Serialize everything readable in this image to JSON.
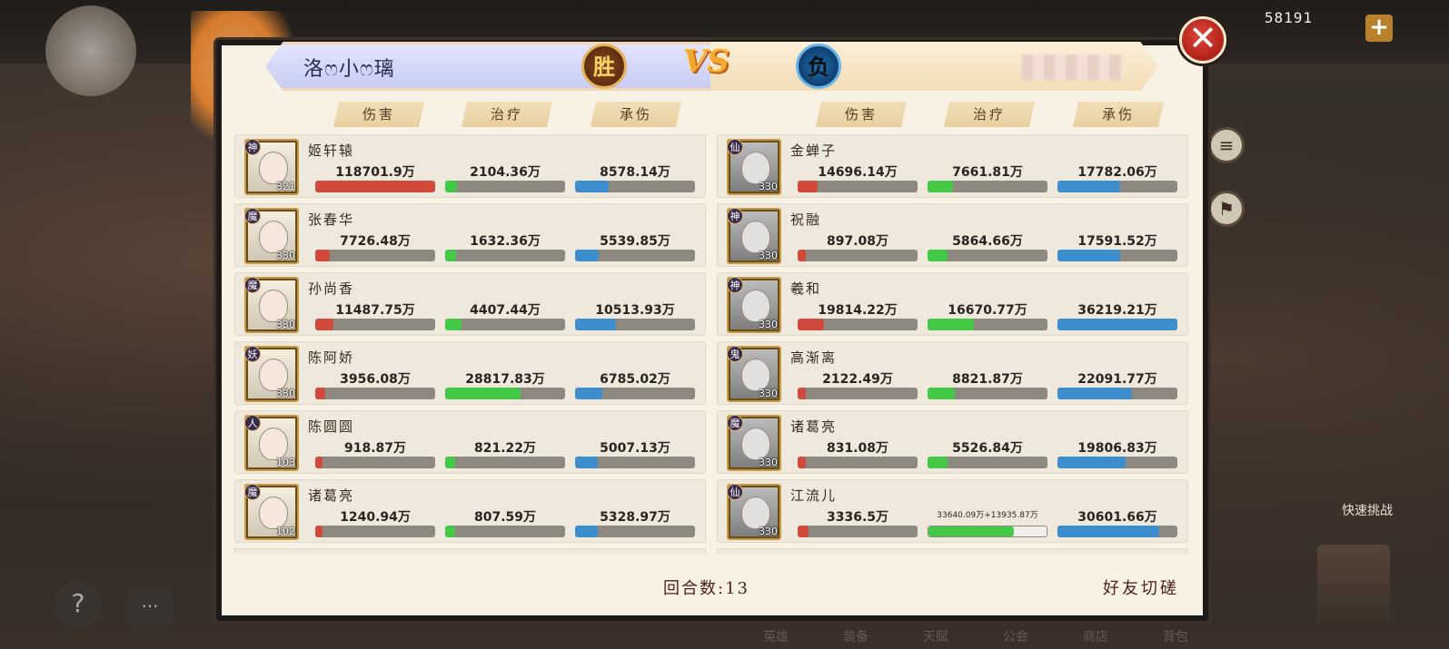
{
  "background": {
    "gold_amount": "58191",
    "plus_label": "+",
    "quick_challenge_label": "快速挑战",
    "help_label": "?",
    "chat_label": "···",
    "nav_items": [
      "英雄",
      "装备",
      "天赋",
      "公会",
      "商店",
      "背包"
    ]
  },
  "close_label": "✕",
  "banner": {
    "left_player": "洛ෆ小ෆ璃",
    "win_label": "胜",
    "vs_label": "VS",
    "lose_label": "负"
  },
  "columns": [
    "伤害",
    "治疗",
    "承伤"
  ],
  "colors": {
    "damage": "#d0493b",
    "heal": "#44c947",
    "tank": "#3e8ece"
  },
  "left_team": [
    {
      "name": "姬轩辕",
      "faction": "神",
      "level": "321",
      "dmg": "118701.9万",
      "heal": "2104.36万",
      "tank": "8578.14万",
      "dmg_pct": 100,
      "heal_pct": 10,
      "tank_pct": 28
    },
    {
      "name": "张春华",
      "faction": "魔",
      "level": "330",
      "dmg": "7726.48万",
      "heal": "1632.36万",
      "tank": "5539.85万",
      "dmg_pct": 12,
      "heal_pct": 9,
      "tank_pct": 20
    },
    {
      "name": "孙尚香",
      "faction": "魔",
      "level": "330",
      "dmg": "11487.75万",
      "heal": "4407.44万",
      "tank": "10513.93万",
      "dmg_pct": 15,
      "heal_pct": 14,
      "tank_pct": 34
    },
    {
      "name": "陈阿娇",
      "faction": "妖",
      "level": "330",
      "dmg": "3956.08万",
      "heal": "28817.83万",
      "tank": "6785.02万",
      "dmg_pct": 8,
      "heal_pct": 63,
      "tank_pct": 23
    },
    {
      "name": "陈圆圆",
      "faction": "人",
      "level": "103",
      "dmg": "918.87万",
      "heal": "821.22万",
      "tank": "5007.13万",
      "dmg_pct": 6,
      "heal_pct": 8,
      "tank_pct": 19
    },
    {
      "name": "诸葛亮",
      "faction": "魔",
      "level": "102",
      "dmg": "1240.94万",
      "heal": "807.59万",
      "tank": "5328.97万",
      "dmg_pct": 6,
      "heal_pct": 8,
      "tank_pct": 19
    }
  ],
  "right_team": [
    {
      "name": "金蝉子",
      "faction": "仙",
      "level": "330",
      "dmg": "14696.14万",
      "heal": "7661.81万",
      "tank": "17782.06万",
      "dmg_pct": 17,
      "heal_pct": 21,
      "tank_pct": 52
    },
    {
      "name": "祝融",
      "faction": "神",
      "level": "330",
      "dmg": "897.08万",
      "heal": "5864.66万",
      "tank": "17591.52万",
      "dmg_pct": 7,
      "heal_pct": 17,
      "tank_pct": 52
    },
    {
      "name": "羲和",
      "faction": "神",
      "level": "330",
      "dmg": "19814.22万",
      "heal": "16670.77万",
      "tank": "36219.21万",
      "dmg_pct": 22,
      "heal_pct": 39,
      "tank_pct": 100
    },
    {
      "name": "高渐离",
      "faction": "鬼",
      "level": "330",
      "dmg": "2122.49万",
      "heal": "8821.87万",
      "tank": "22091.77万",
      "dmg_pct": 7,
      "heal_pct": 23,
      "tank_pct": 62
    },
    {
      "name": "诸葛亮",
      "faction": "魔",
      "level": "330",
      "dmg": "831.08万",
      "heal": "5526.84万",
      "tank": "19806.83万",
      "dmg_pct": 7,
      "heal_pct": 17,
      "tank_pct": 57
    },
    {
      "name": "江流儿",
      "faction": "仙",
      "level": "330",
      "dmg": "3336.5万",
      "heal": "33640.09万+13935.87万",
      "tank": "30601.66万",
      "dmg_pct": 9,
      "heal_pct": 72,
      "tank_pct": 85
    }
  ],
  "footer": {
    "rounds": "回合数:13",
    "mode": "好友切磋"
  }
}
